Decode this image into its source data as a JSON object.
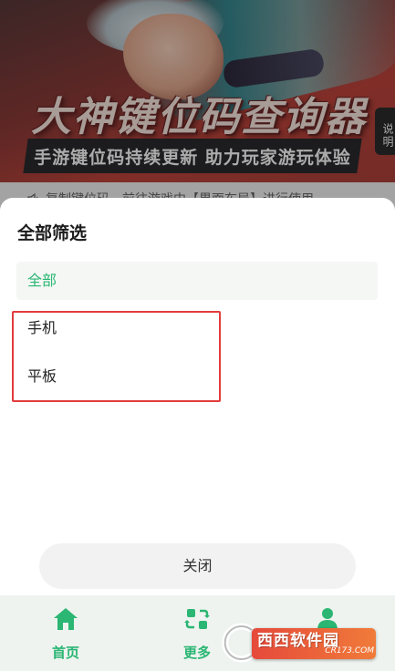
{
  "banner": {
    "title": "大神键位码查询器",
    "subtitle": "手游键位码持续更新 助力玩家游玩体验",
    "notice": "复制键位码，前往游戏中【界面布局】进行使用~",
    "side_tab": "说明"
  },
  "filter_sheet": {
    "title": "全部筛选",
    "options": [
      {
        "label": "全部",
        "selected": true
      },
      {
        "label": "手机",
        "selected": false
      },
      {
        "label": "平板",
        "selected": false
      }
    ],
    "close_label": "关闭"
  },
  "bottom_nav": {
    "items": [
      {
        "label": "首页",
        "icon": "home-icon",
        "active": true
      },
      {
        "label": "更多",
        "icon": "refresh-icon",
        "active": false
      },
      {
        "label": "",
        "icon": "user-icon",
        "active": false
      }
    ]
  },
  "watermark": {
    "text": "西西软件园",
    "sub": "CR173.COM"
  },
  "colors": {
    "accent": "#2bb673",
    "highlight": "#e23b3b",
    "nav_bg": "#eef3ef"
  }
}
